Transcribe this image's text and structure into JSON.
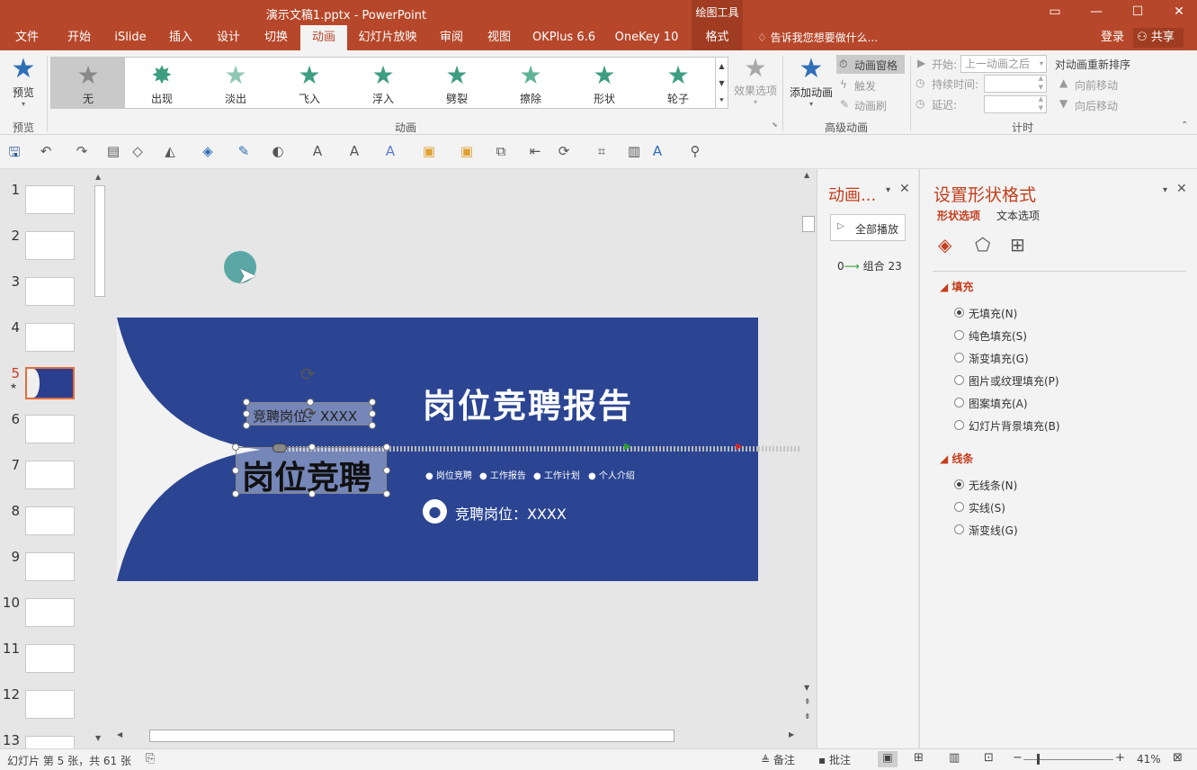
{
  "window": {
    "title": "演示文稿1.pptx - PowerPoint",
    "context_group": "绘图工具",
    "buttons": {
      "ribbon_opts": "ribbon-display-options",
      "minimize": "minimize",
      "maximize": "maximize",
      "close": "close"
    }
  },
  "tabs": [
    "文件",
    "开始",
    "iSlide",
    "插入",
    "设计",
    "切换",
    "动画",
    "幻灯片放映",
    "审阅",
    "视图",
    "OKPlus 6.6",
    "OneKey 10",
    "格式"
  ],
  "active_tab": "动画",
  "tell_me": "告诉我您想要做什么...",
  "login": "登录",
  "share": "共享",
  "ribbon": {
    "preview": {
      "label": "预览",
      "group": "预览"
    },
    "gallery": [
      "无",
      "出现",
      "淡出",
      "飞入",
      "浮入",
      "劈裂",
      "擦除",
      "形状",
      "轮子"
    ],
    "group_animation": "动画",
    "effect_options": "效果选项",
    "add_animation": "添加动画",
    "anim_pane": "动画窗格",
    "trigger": "触发",
    "anim_painter": "动画刷",
    "group_advanced": "高级动画",
    "start_label": "开始:",
    "start_value": "上一动画之后",
    "duration_label": "持续时间:",
    "delay_label": "延迟:",
    "reorder_title": "对动画重新排序",
    "move_earlier": "向前移动",
    "move_later": "向后移动",
    "group_timing": "计时"
  },
  "thumbs": [
    "1",
    "2",
    "3",
    "4",
    "5",
    "6",
    "7",
    "8",
    "9",
    "10",
    "11",
    "12",
    "13"
  ],
  "slide": {
    "title": "岗位竞聘报告",
    "bullets": [
      "岗位竞聘",
      "工作报告",
      "工作计划",
      "个人介绍"
    ],
    "position_text": "竞聘岗位：XXXX",
    "small_box": "竞聘岗位：XXXX",
    "big_box": "岗位竞聘"
  },
  "anim_pane": {
    "title": "动画...",
    "play_all": "全部播放",
    "item_index": "0",
    "item_label": "组合 23"
  },
  "format_pane": {
    "title": "设置形状格式",
    "tab_shape": "形状选项",
    "tab_text": "文本选项",
    "fill_header": "填充",
    "fill_options": [
      "无填充(N)",
      "纯色填充(S)",
      "渐变填充(G)",
      "图片或纹理填充(P)",
      "图案填充(A)",
      "幻灯片背景填充(B)"
    ],
    "line_header": "线条",
    "line_options": [
      "无线条(N)",
      "实线(S)",
      "渐变线(G)"
    ]
  },
  "status": {
    "slide_info": "幻灯片 第 5 张，共 61 张",
    "notes": "备注",
    "comments": "批注",
    "zoom": "41%"
  },
  "colors": {
    "accent": "#b7472a",
    "slide_bg": "#2b4593",
    "star_green": "#3e9e7f"
  }
}
